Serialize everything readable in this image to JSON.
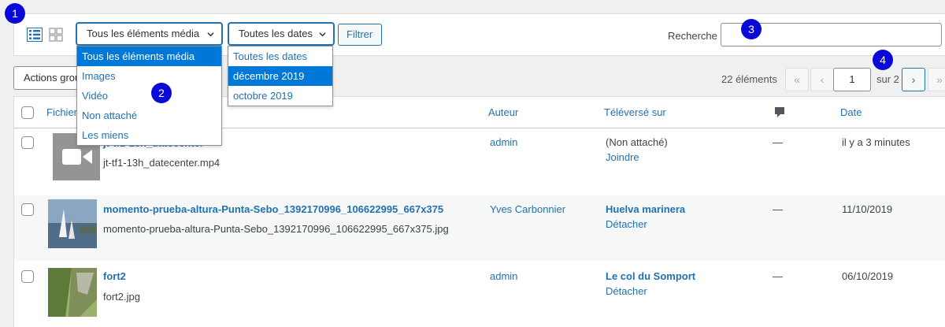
{
  "toolbar": {
    "type_filter": {
      "selected": "Tous les éléments média",
      "options": [
        "Tous les éléments média",
        "Images",
        "Vidéo",
        "Non attaché",
        "Les miens"
      ]
    },
    "date_filter": {
      "selected": "Toutes les dates",
      "options": [
        "Toutes les dates",
        "décembre 2019",
        "octobre 2019"
      ]
    },
    "filter_button": "Filtrer",
    "search_label": "Recherche",
    "search_value": ""
  },
  "bulk_actions": "Actions groupées",
  "pagination": {
    "count": "22 éléments",
    "first": "«",
    "prev": "‹",
    "current": "1",
    "of_total": "sur 2",
    "next": "›",
    "last": "»"
  },
  "table": {
    "headers": {
      "file": "Fichier",
      "author": "Auteur",
      "uploaded_to": "Téléversé sur",
      "date": "Date"
    },
    "rows": [
      {
        "title": "jt-tf1-13h_datecenter",
        "filename": "jt-tf1-13h_datecenter.mp4",
        "author": "admin",
        "attached_to": "(Non attaché)",
        "attach_action": "Joindre",
        "comments": "—",
        "date": "il y a 3 minutes"
      },
      {
        "title": "momento-prueba-altura-Punta-Sebo_1392170996_106622995_667x375",
        "filename": "momento-prueba-altura-Punta-Sebo_1392170996_106622995_667x375.jpg",
        "author": "Yves Carbonnier",
        "attached_to": "Huelva marinera",
        "attach_action": "Détacher",
        "comments": "—",
        "date": "11/10/2019"
      },
      {
        "title": "fort2",
        "filename": "fort2.jpg",
        "author": "admin",
        "attached_to": "Le col du Somport",
        "attach_action": "Détacher",
        "comments": "—",
        "date": "06/10/2019"
      }
    ]
  },
  "badges": [
    "1",
    "2",
    "3",
    "4"
  ],
  "colors": {
    "link": "#2271b1",
    "selected_option": "#0078d7",
    "badge": "#0a0ad8"
  },
  "icons": {
    "list_view": "list-view-icon",
    "grid_view": "grid-view-icon",
    "comments": "comment-bubble-icon",
    "video": "video-camera-icon"
  }
}
